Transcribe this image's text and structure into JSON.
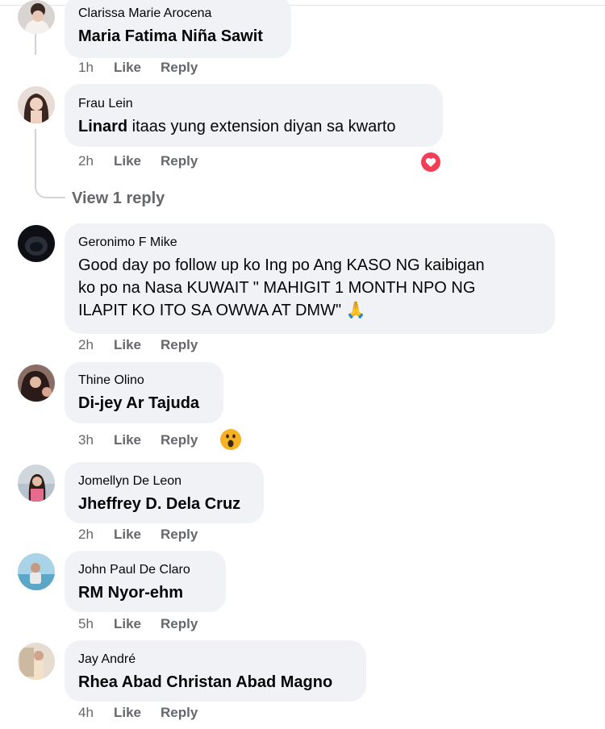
{
  "comments": [
    {
      "author": "Clarissa Marie Arocena",
      "mention": "Maria Fatima Niña Sawit",
      "text": "",
      "time": "1h",
      "like": "Like",
      "reply": "Reply"
    },
    {
      "author": "Frau Lein",
      "mention": "Linard",
      "text": " itaas yung extension diyan sa kwarto",
      "time": "2h",
      "like": "Like",
      "reply": "Reply",
      "reaction": "love"
    },
    {
      "author": "Geronimo F Mike",
      "mention": "",
      "text_lines": [
        "Good day po follow up ko Ing po Ang KASO NG kaibigan",
        "ko po na Nasa KUWAIT \" MAHIGIT 1 MONTH NPO NG",
        "ILAPIT KO ITO SA OWWA AT DMW\" 🙏"
      ],
      "time": "2h",
      "like": "Like",
      "reply": "Reply"
    },
    {
      "author": "Thine Olino",
      "mention": "Di-jey Ar Tajuda",
      "text": "",
      "time": "3h",
      "like": "Like",
      "reply": "Reply",
      "reaction": "wow"
    },
    {
      "author": "Jomellyn De Leon",
      "mention": "Jheffrey D. Dela Cruz",
      "text": "",
      "time": "2h",
      "like": "Like",
      "reply": "Reply"
    },
    {
      "author": "John Paul De Claro",
      "mention": "RM Nyor-ehm",
      "text": "",
      "time": "5h",
      "like": "Like",
      "reply": "Reply"
    },
    {
      "author": "Jay André",
      "mention": "Rhea Abad Christan Abad Magno",
      "text": "",
      "time": "4h",
      "like": "Like",
      "reply": "Reply"
    }
  ],
  "view_reply": "View 1 reply",
  "colors": {
    "bubble": "#f0f2f5",
    "meta": "#65676b",
    "love": "#f33e58",
    "wow": "#f7b125"
  }
}
